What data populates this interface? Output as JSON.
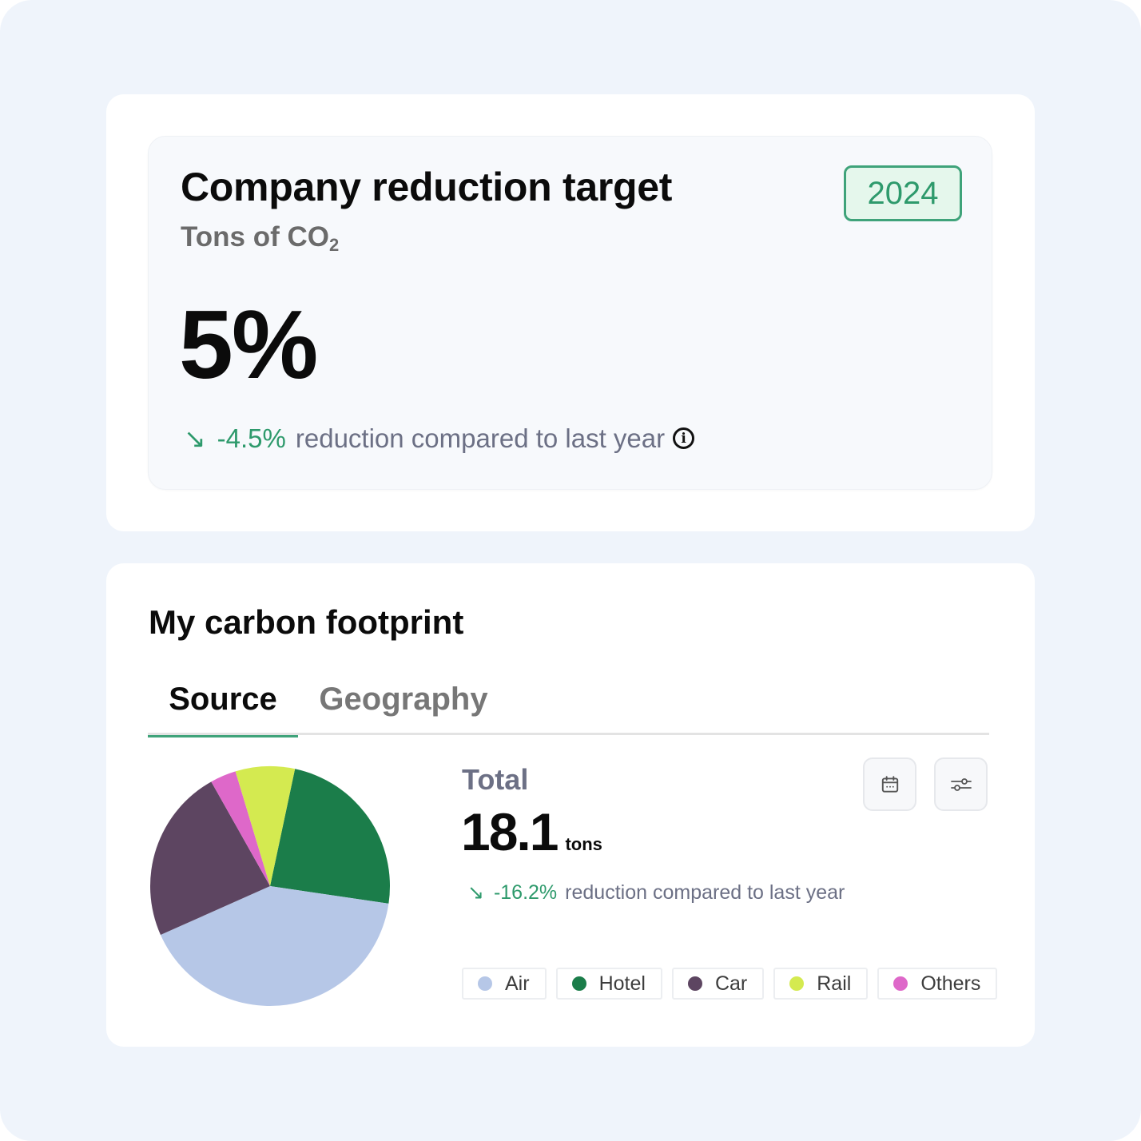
{
  "target_card": {
    "title": "Company reduction target",
    "subtitle_main": "Tons of CO",
    "subtitle_sub": "2",
    "year_badge": "2024",
    "value": "5%",
    "trend": {
      "arrow": "↘",
      "percent": "-4.5%",
      "text": "reduction compared to last year"
    },
    "info_glyph": "i"
  },
  "footprint_card": {
    "title": "My carbon footprint",
    "tabs": [
      {
        "label": "Source",
        "active": true
      },
      {
        "label": "Geography",
        "active": false
      }
    ],
    "total_label": "Total",
    "total_value": "18.1",
    "total_unit": "tons",
    "trend": {
      "arrow": "↘",
      "percent": "-16.2%",
      "text": "reduction compared to last year"
    },
    "buttons": [
      {
        "name": "calendar-button",
        "icon": "calendar-icon"
      },
      {
        "name": "filter-button",
        "icon": "sliders-icon"
      }
    ]
  },
  "colors": {
    "accent_green": "#2e9a6c",
    "badge_bg": "#e5f7ec",
    "muted_text": "#6c7085"
  },
  "chart_data": {
    "type": "pie",
    "title": "",
    "start_angle_deg": 12,
    "direction": "clockwise",
    "slices": [
      {
        "label": "Hotel",
        "value": 24,
        "color": "#1b7d4a"
      },
      {
        "label": "Air",
        "value": 41,
        "color": "#b6c7e7"
      },
      {
        "label": "Car",
        "value": 23.5,
        "color": "#5d4561"
      },
      {
        "label": "Others",
        "value": 3.5,
        "color": "#de68c9"
      },
      {
        "label": "Rail",
        "value": 8,
        "color": "#d4ea50"
      }
    ],
    "legend": [
      {
        "label": "Air",
        "color": "#b6c7e7"
      },
      {
        "label": "Hotel",
        "color": "#1b7d4a"
      },
      {
        "label": "Car",
        "color": "#5d4561"
      },
      {
        "label": "Rail",
        "color": "#d4ea50"
      },
      {
        "label": "Others",
        "color": "#de68c9"
      }
    ],
    "legend_position": "right-bottom"
  }
}
